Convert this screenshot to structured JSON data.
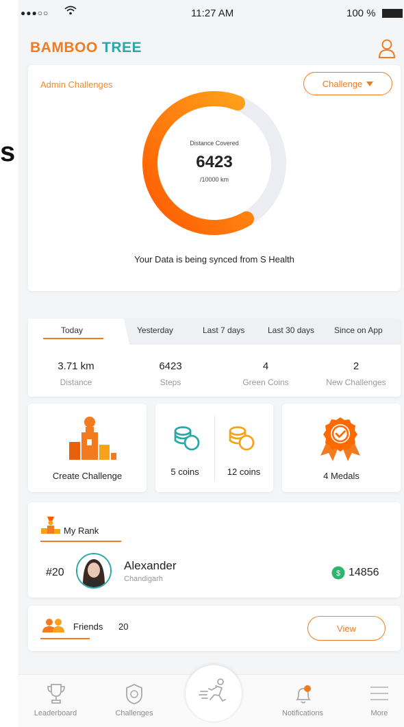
{
  "status_bar": {
    "signal": "●●●○○",
    "time": "11:27 AM",
    "battery": "100 %"
  },
  "header": {
    "brand_part1": "BAMBOO",
    "brand_part2": "TREE",
    "profile_icon": "user-icon"
  },
  "edge_artifact": "s",
  "admin": {
    "title": "Admin Challenges",
    "challenge_button": "Challenge",
    "distance_label": "Distance Covered",
    "distance_value": "6423",
    "distance_unit": "/10000 km",
    "progress": 0.6423,
    "sync_text": "Your Data is being synced from S Health",
    "colors": {
      "ring_start": "#ff5a00",
      "ring_end": "#ffa21c",
      "track": "#ebedf2"
    }
  },
  "periods": {
    "tabs": [
      "Today",
      "Yesterday",
      "Last 7 days",
      "Last 30 days",
      "Since on App"
    ],
    "active": "Today"
  },
  "stats": [
    {
      "value": "3.71 km",
      "label": "Distance"
    },
    {
      "value": "6423",
      "label": "Steps"
    },
    {
      "value": "4",
      "label": "Green Coins"
    },
    {
      "value": "2",
      "label": "New Challenges"
    }
  ],
  "cards": {
    "create": "Create Challenge",
    "green_coins": "5 coins",
    "gold_coins": "12 coins",
    "medals": "4 Medals"
  },
  "rank": {
    "title": "My Rank",
    "position": "#20",
    "name": "Alexander",
    "city": "Chandigarh",
    "score": "14856"
  },
  "friends": {
    "label": "Friends",
    "count": "20",
    "view_button": "View"
  },
  "nav": {
    "items": [
      "Leaderboard",
      "Challenges",
      "Notifications",
      "More"
    ]
  },
  "colors": {
    "accent_orange": "#f27b1f",
    "brand_teal": "#2aa8a8",
    "coin_green": "#2db56c",
    "coin_gold": "#f7a21b"
  }
}
